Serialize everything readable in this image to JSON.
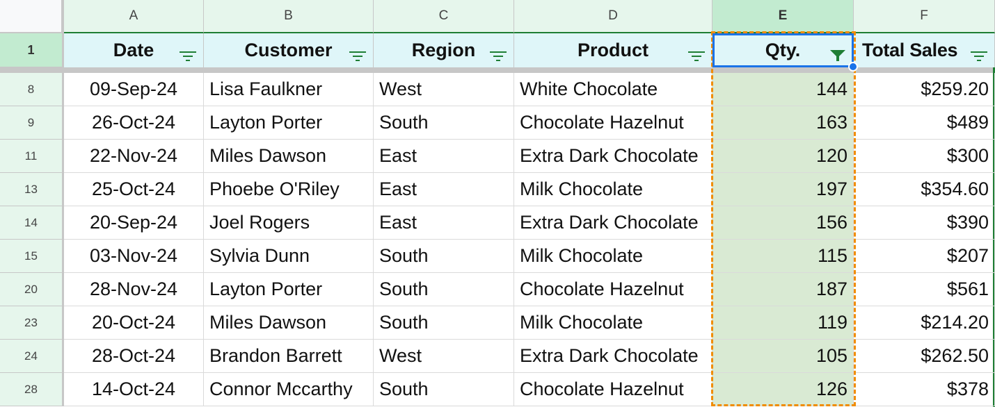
{
  "columns": [
    {
      "letter": "A",
      "header": "Date",
      "filter_active": false
    },
    {
      "letter": "B",
      "header": "Customer",
      "filter_active": false
    },
    {
      "letter": "C",
      "header": "Region",
      "filter_active": false
    },
    {
      "letter": "D",
      "header": "Product",
      "filter_active": false
    },
    {
      "letter": "E",
      "header": "Qty.",
      "filter_active": true
    },
    {
      "letter": "F",
      "header": "Total Sales",
      "filter_active": false
    }
  ],
  "header_row_number": "1",
  "selected_cell": "E1",
  "colors": {
    "filter_icon": "#1e7e34",
    "selection": "#1a73e8",
    "copy_border": "#f08c00",
    "qty_fill": "#d9ead3",
    "header_fill": "#dff6f9"
  },
  "rows": [
    {
      "num": "8",
      "date": "09-Sep-24",
      "customer": "Lisa Faulkner",
      "region": "West",
      "product": "White Chocolate",
      "qty": "144",
      "sales": "$259.20"
    },
    {
      "num": "9",
      "date": "26-Oct-24",
      "customer": "Layton Porter",
      "region": "South",
      "product": "Chocolate Hazelnut",
      "qty": "163",
      "sales": "$489"
    },
    {
      "num": "11",
      "date": "22-Nov-24",
      "customer": "Miles Dawson",
      "region": "East",
      "product": "Extra Dark Chocolate",
      "qty": "120",
      "sales": "$300"
    },
    {
      "num": "13",
      "date": "25-Oct-24",
      "customer": "Phoebe O'Riley",
      "region": "East",
      "product": "Milk Chocolate",
      "qty": "197",
      "sales": "$354.60"
    },
    {
      "num": "14",
      "date": "20-Sep-24",
      "customer": "Joel Rogers",
      "region": "East",
      "product": "Extra Dark Chocolate",
      "qty": "156",
      "sales": "$390"
    },
    {
      "num": "15",
      "date": "03-Nov-24",
      "customer": "Sylvia Dunn",
      "region": "South",
      "product": "Milk Chocolate",
      "qty": "115",
      "sales": "$207"
    },
    {
      "num": "20",
      "date": "28-Nov-24",
      "customer": "Layton Porter",
      "region": "South",
      "product": "Chocolate Hazelnut",
      "qty": "187",
      "sales": "$561"
    },
    {
      "num": "23",
      "date": "20-Oct-24",
      "customer": "Miles Dawson",
      "region": "South",
      "product": "Milk Chocolate",
      "qty": "119",
      "sales": "$214.20"
    },
    {
      "num": "24",
      "date": "28-Oct-24",
      "customer": "Brandon Barrett",
      "region": "West",
      "product": "Extra Dark Chocolate",
      "qty": "105",
      "sales": "$262.50"
    },
    {
      "num": "28",
      "date": "14-Oct-24",
      "customer": "Connor Mccarthy",
      "region": "South",
      "product": "Chocolate Hazelnut",
      "qty": "126",
      "sales": "$378"
    }
  ]
}
